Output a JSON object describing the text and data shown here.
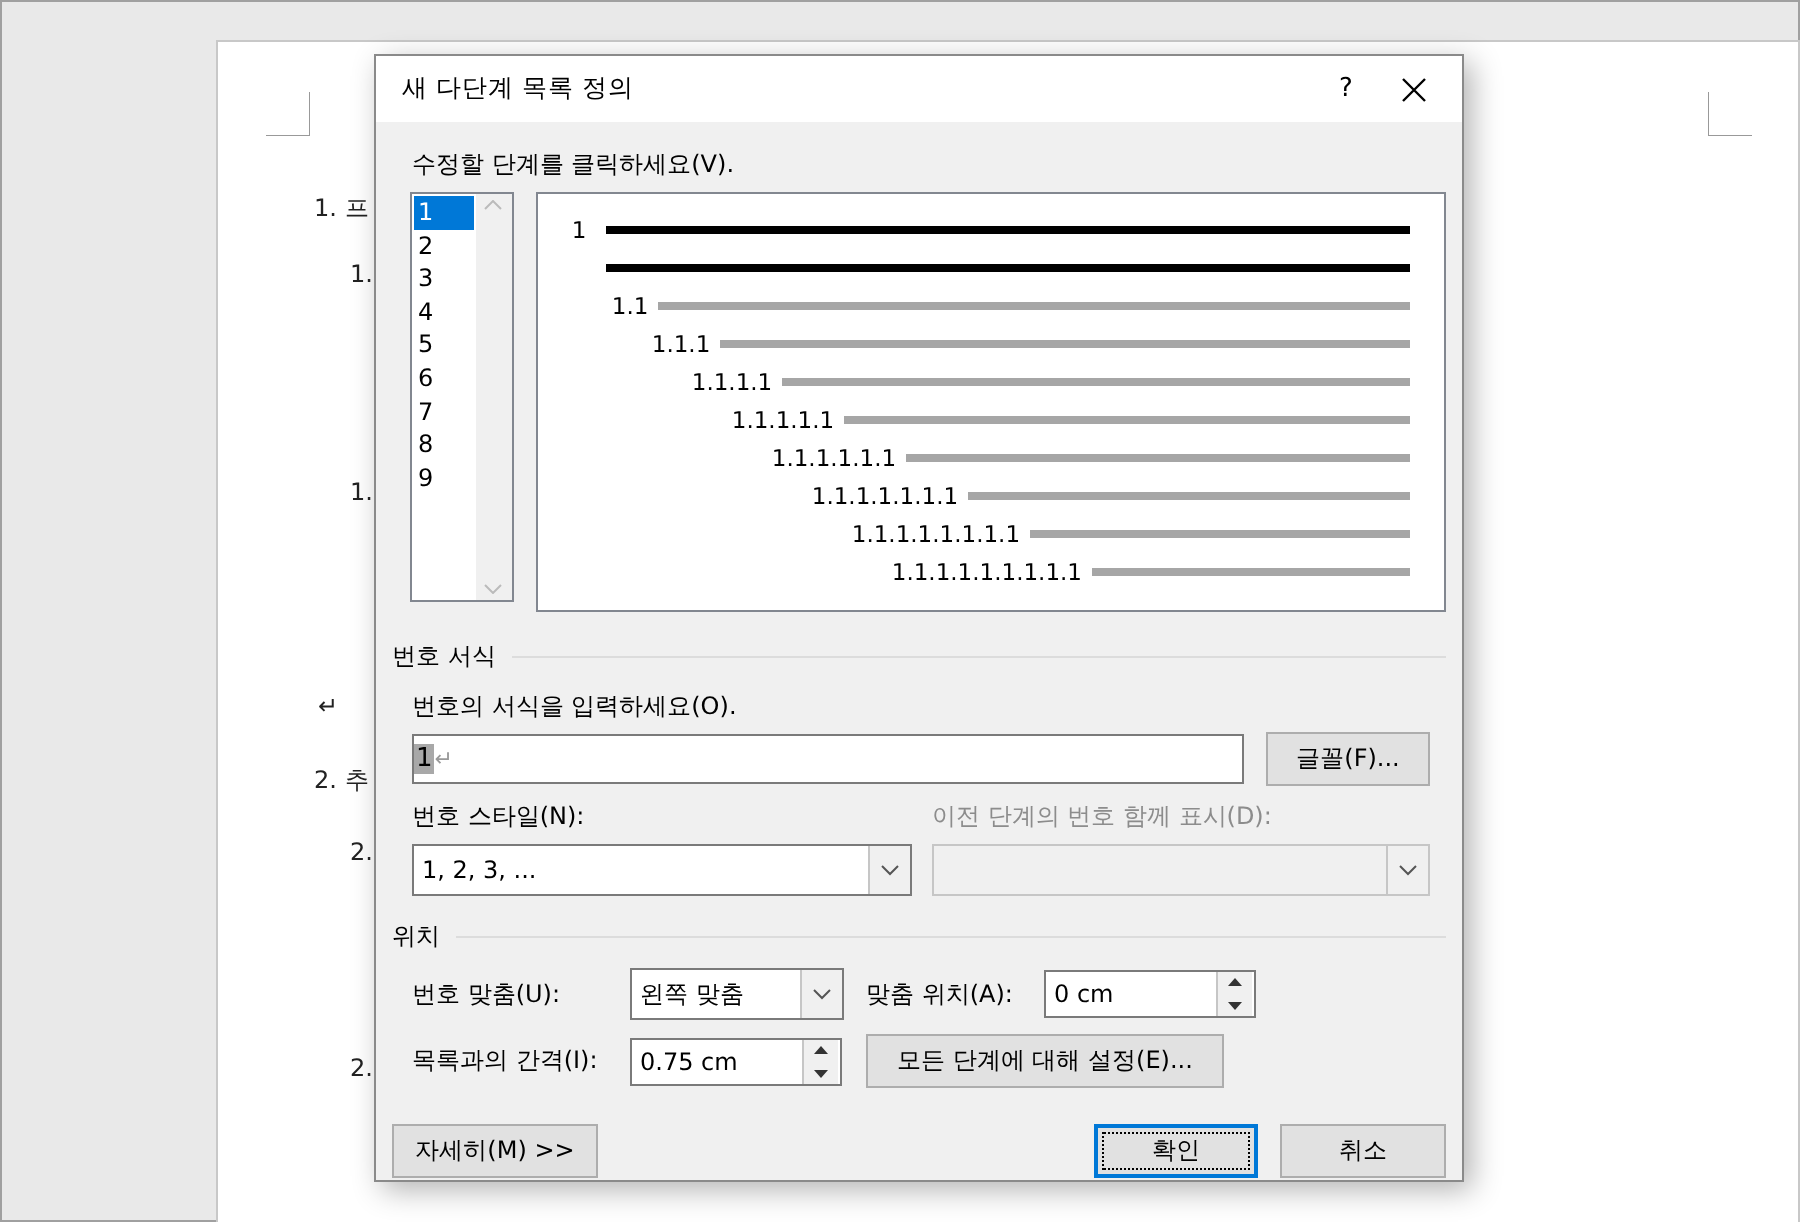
{
  "document": {
    "lines": [
      "1. 프",
      "1.",
      "1.",
      "↵",
      "2. 추",
      "2.",
      "2."
    ]
  },
  "dialog": {
    "title": "새 다단계 목록 정의",
    "help": "?",
    "level_prompt": "수정할 단계를 클릭하세요(V).",
    "levels": [
      {
        "label": "1",
        "selected": true
      },
      {
        "label": "2",
        "selected": false
      },
      {
        "label": "3",
        "selected": false
      },
      {
        "label": "4",
        "selected": false
      },
      {
        "label": "5",
        "selected": false
      },
      {
        "label": "6",
        "selected": false
      },
      {
        "label": "7",
        "selected": false
      },
      {
        "label": "8",
        "selected": false
      },
      {
        "label": "9",
        "selected": false
      }
    ],
    "preview": [
      "1",
      "1.1",
      "1.1.1",
      "1.1.1.1",
      "1.1.1.1.1",
      "1.1.1.1.1.1",
      "1.1.1.1.1.1.1",
      "1.1.1.1.1.1.1.1",
      "1.1.1.1.1.1.1.1.1"
    ],
    "number_format": {
      "heading": "번호 서식",
      "prompt": "번호의 서식을 입력하세요(O).",
      "value": "1",
      "return_mark": "↵",
      "font_button": "글꼴(F)...",
      "style_label": "번호 스타일(N):",
      "style_value": "1, 2, 3, ...",
      "include_label": "이전 단계의 번호 함께 표시(D):",
      "include_disabled": true
    },
    "position": {
      "heading": "위치",
      "align_label": "번호 맞춤(U):",
      "align_value": "왼쪽 맞춤",
      "at_label": "맞춤 위치(A):",
      "at_value": "0 cm",
      "indent_label": "목록과의 간격(I):",
      "indent_value": "0.75 cm",
      "set_all_button": "모든 단계에 대해 설정(E)..."
    },
    "buttons": [
      {
        "label": "자세히(M) >>",
        "kind": "more",
        "default": false
      },
      {
        "label": "확인",
        "kind": "ok",
        "default": true
      },
      {
        "label": "취소",
        "kind": "cancel",
        "default": false
      }
    ]
  }
}
